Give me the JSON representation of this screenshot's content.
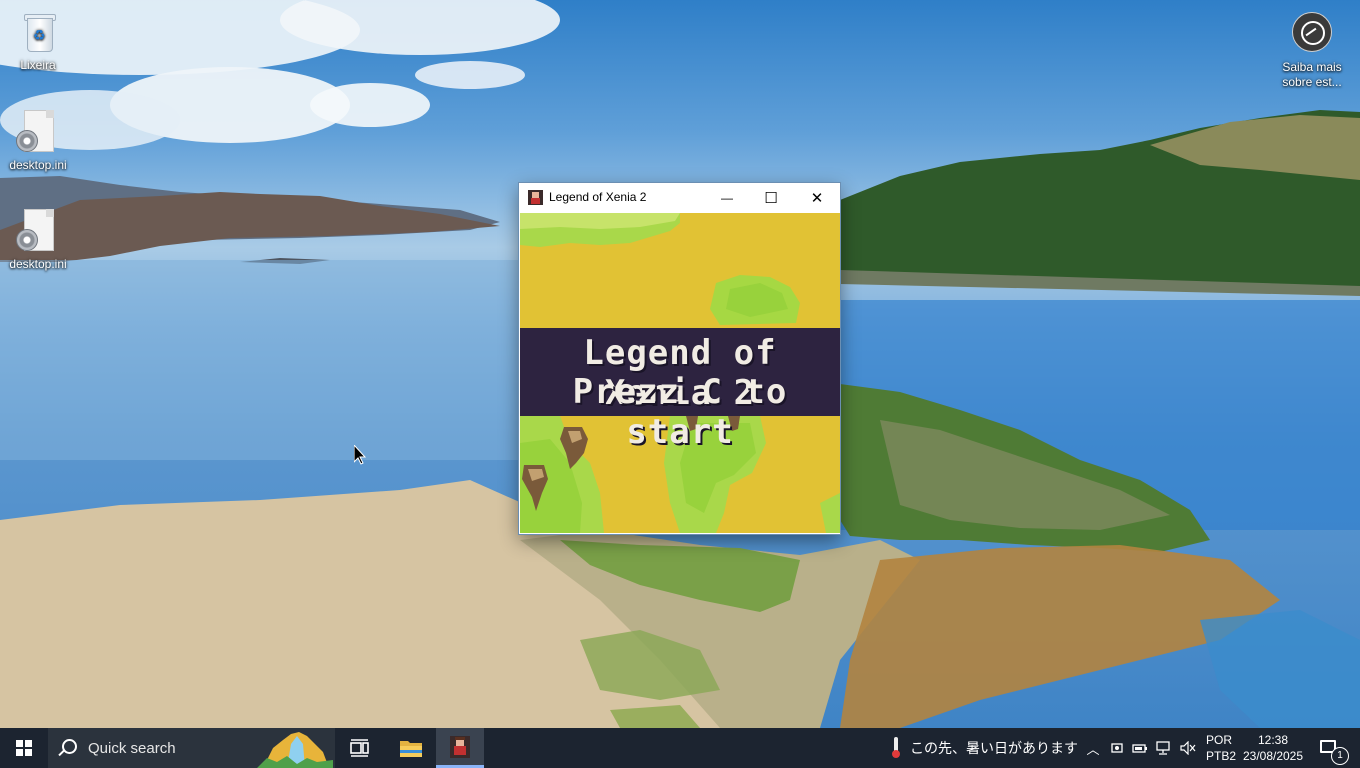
{
  "desktop": {
    "icons": [
      {
        "label": "Lixeira",
        "icon": "recycle-bin-icon"
      },
      {
        "label": "desktop.ini",
        "icon": "settings-file-icon"
      },
      {
        "label": "desktop.ini",
        "icon": "settings-file-icon"
      },
      {
        "label": "Saiba mais sobre est...",
        "icon": "learn-more-icon"
      }
    ]
  },
  "window": {
    "title": "Legend of Xenia 2",
    "minimize": "—",
    "maximize": "☐",
    "close": "✕",
    "game": {
      "title_line": "Legend of Xenia 2",
      "prompt_line": "Prezz C to start"
    }
  },
  "taskbar": {
    "search_placeholder": "Quick search",
    "news_text": "この先、暑い日があります",
    "language": {
      "code": "POR",
      "layout": "PTB2"
    },
    "clock": {
      "time": "12:38",
      "date": "23/08/2025"
    },
    "notification_count": "1",
    "colors": {
      "accent": "#8ab4f8",
      "background": "#1c2430"
    }
  }
}
